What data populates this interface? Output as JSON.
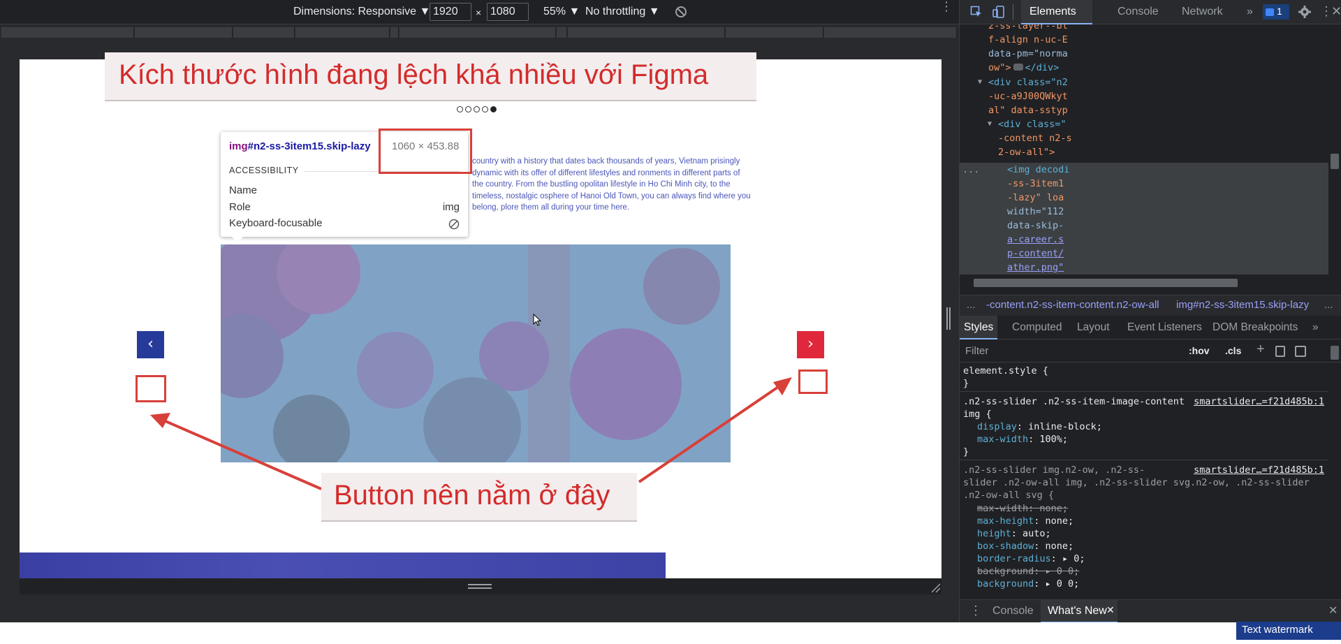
{
  "device_toolbar": {
    "dimensions_label": "Dimensions: Responsive ▼",
    "width_value": "1920",
    "times": "×",
    "height_value": "1080",
    "zoom_label": "55% ▼",
    "throttle_label": "No throttling ▼"
  },
  "page": {
    "body_text": "country with a history that dates back thousands of years, Vietnam prisingly dynamic with its offer of different lifestyles and ronments in different parts of the country. From the bustling opolitan lifestyle in Ho Chi Minh city, to the timeless, nostalgic osphere of Hanoi Old Town, you can always find where you belong, plore them all during your time here.",
    "prev_glyph": "‹",
    "next_glyph": "›",
    "slides_total": 5,
    "slide_active": 5
  },
  "tooltip": {
    "selector_tag": "img",
    "selector_id": "#n2-ss-3item15.skip-lazy",
    "size": "1060 × 453.88",
    "section": "ACCESSIBILITY",
    "rows": [
      {
        "label": "Name",
        "value": ""
      },
      {
        "label": "Role",
        "value": "img"
      },
      {
        "label": "Keyboard-focusable",
        "value": "⃠"
      }
    ]
  },
  "annotations": {
    "top": "Kích thước hình đang lệch khá nhiều với Figma",
    "bottom": "Button nên nằm ở đây"
  },
  "devtools": {
    "tabs": [
      "Elements",
      "Console",
      "Network",
      "»"
    ],
    "active_tab": "Elements",
    "issues_count": "1",
    "breadcrumb": {
      "ellipsis": "...",
      "item1": "-content.n2-ss-item-content.n2-ow-all",
      "item2": "img#n2-ss-3item15.skip-lazy",
      "ellipsis2": "..."
    },
    "subtabs": [
      "Styles",
      "Computed",
      "Layout",
      "Event Listeners",
      "DOM Breakpoints",
      "»"
    ],
    "filter_placeholder": "Filter",
    "hov": ":hov",
    "cls": ".cls",
    "element_lines": [
      "2-ss-layer--bl",
      "f-align n-uc-E",
      "data-pm=\"norma",
      "ow\">",
      "</div>",
      "<div class=\"n2",
      "-uc-a9J00QWkyt",
      "al\" data-sstyp",
      "<div class=\"",
      "-content n2-s",
      "2-ow-all\">",
      "...",
      "<img decodi",
      "-ss-3item1",
      "-lazy\" loa",
      "width=\"112",
      "data-skip-",
      "a-career.s",
      "p-content/",
      "ather.png\""
    ],
    "styles": {
      "element_style": "element.style {",
      "close": "}",
      "rule1_selector": ".n2-ss-slider .n2-ss-item-image-content img {",
      "rule1_source": "smartslider…=f21d485b:1",
      "rule1_props": [
        {
          "name": "display",
          "value": "inline-block;"
        },
        {
          "name": "max-width",
          "value": "100%;"
        }
      ],
      "rule2_selector_a": ".n2-ss-slider img.n2-ow, .n2-ss-",
      "rule2_selector_b": "slider .n2-ow-all img, .n2-ss-slider svg.n2-ow, .n2-ss-slider",
      "rule2_selector_c": ".n2-ow-all svg {",
      "rule2_source": "smartslider…=f21d485b:1",
      "rule2_props": [
        {
          "name": "max-width",
          "value": "none;",
          "strike": true
        },
        {
          "name": "max-height",
          "value": "none;"
        },
        {
          "name": "height",
          "value": "auto;"
        },
        {
          "name": "box-shadow",
          "value": "none;"
        },
        {
          "name": "border-radius",
          "value": "▸ 0;"
        },
        {
          "name": "background",
          "value": "▸ 0 0;",
          "strike": true
        },
        {
          "name": "background",
          "value": "▸ 0 0;"
        }
      ]
    },
    "drawer_tabs": [
      "Console",
      "What's New"
    ],
    "drawer_active": "What's New"
  },
  "watermark": "Text watermark",
  "colors": {
    "annotation_red": "#d42b2b",
    "prev_button": "#263a9a",
    "next_button": "#e0283c",
    "highlight_overlay": "#6f9fd8"
  }
}
